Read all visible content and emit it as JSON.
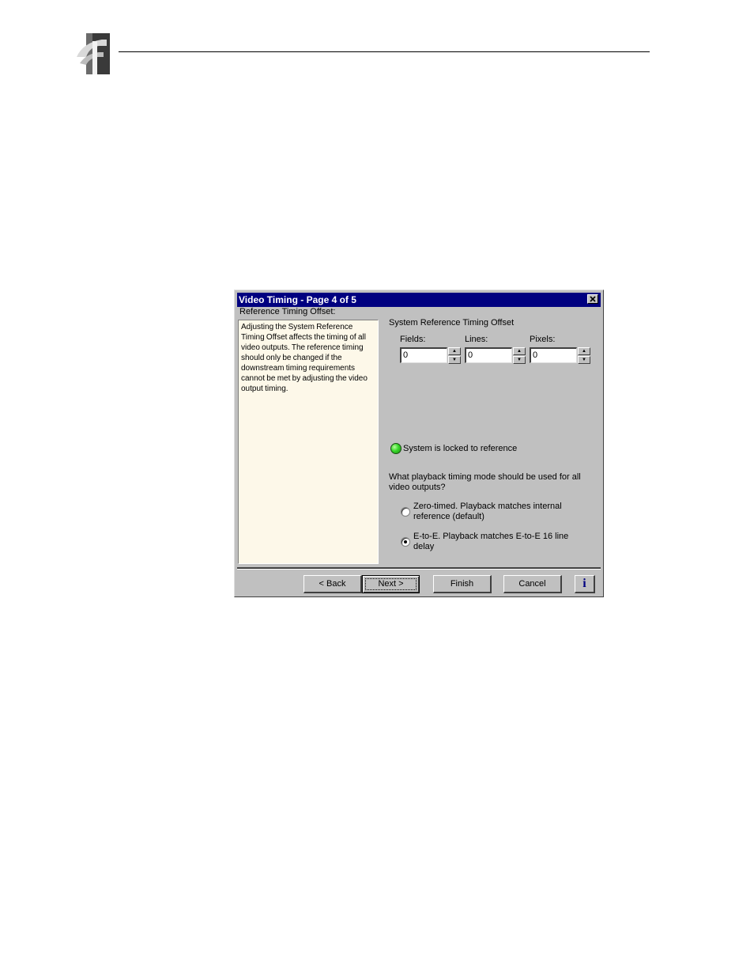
{
  "dialog": {
    "title": "Video Timing - Page 4 of 5",
    "section_label": "Reference Timing Offset:",
    "help_text": "Adjusting the System Reference Timing Offset affects the timing of all video outputs.  The reference timing should only be changed if the downstream timing requirements cannot be met by adjusting the video output timing.",
    "group_title": "System Reference Timing Offset",
    "fields": [
      {
        "label": "Fields:",
        "value": "0"
      },
      {
        "label": "Lines:",
        "value": "0"
      },
      {
        "label": "Pixels:",
        "value": "0"
      }
    ],
    "status": {
      "text": "System is locked to reference",
      "led_color": "#33cc33"
    },
    "question": "What playback timing mode should be used for all video outputs?",
    "options": [
      {
        "label": "Zero-timed. Playback matches internal reference (default)",
        "selected": false
      },
      {
        "label": "E-to-E. Playback matches E-to-E 16 line delay",
        "selected": true
      }
    ],
    "buttons": {
      "back": "< Back",
      "next": "Next >",
      "finish": "Finish",
      "cancel": "Cancel",
      "info": "i"
    }
  },
  "colors": {
    "titlebar": "#000080",
    "dialog_bg": "#c0c0c0",
    "help_bg": "#fdf8e9"
  }
}
